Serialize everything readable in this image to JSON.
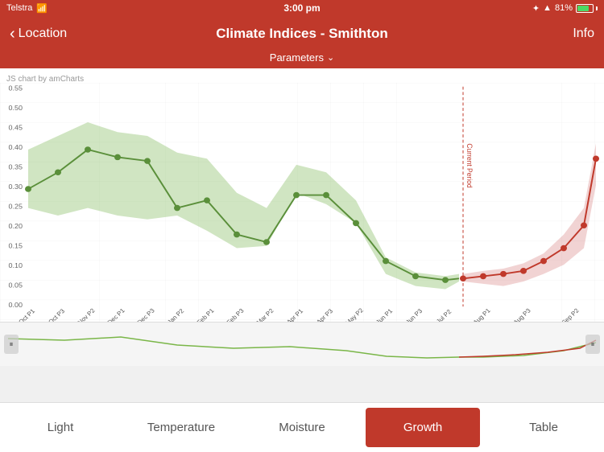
{
  "statusBar": {
    "carrier": "Telstra",
    "time": "3:00 pm",
    "batteryPercent": "81%"
  },
  "navBar": {
    "backLabel": "Location",
    "title": "Climate Indices - Smithton",
    "infoLabel": "Info"
  },
  "parametersLabel": "Parameters",
  "chartWatermark": "JS chart by amCharts",
  "currentPeriodLabel": "Current Period",
  "yAxis": {
    "labels": [
      "0.55",
      "0.50",
      "0.45",
      "0.40",
      "0.35",
      "0.30",
      "0.25",
      "0.20",
      "0.15",
      "0.10",
      "0.05",
      "0.00"
    ]
  },
  "xAxis": {
    "labels": [
      "Oct P1",
      "Oct P3",
      "Nov P2",
      "Dec P1",
      "Dec P3",
      "Jan P2",
      "Feb P1",
      "Feb P3",
      "Mar P2",
      "Apr P1",
      "Apr P3",
      "May P2",
      "Jun P1",
      "Jun P3",
      "Jul P2",
      "Aug P1",
      "Aug P3",
      "Sep P2"
    ]
  },
  "tabs": [
    {
      "id": "light",
      "label": "Light",
      "active": false
    },
    {
      "id": "temperature",
      "label": "Temperature",
      "active": false
    },
    {
      "id": "moisture",
      "label": "Moisture",
      "active": false
    },
    {
      "id": "growth",
      "label": "Growth",
      "active": true
    },
    {
      "id": "table",
      "label": "Table",
      "active": false
    }
  ],
  "colors": {
    "header": "#c0392b",
    "activeTab": "#c0392b",
    "greenLine": "#4a7c3f",
    "greenFill": "rgba(120,180,80,0.35)",
    "redLine": "#c0392b",
    "redFill": "rgba(200,80,80,0.25)",
    "currentPeriodLine": "#c0392b"
  }
}
